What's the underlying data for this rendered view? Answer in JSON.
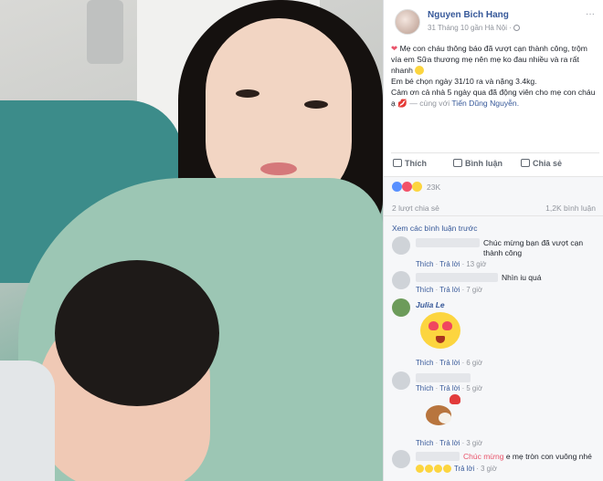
{
  "photo": {
    "description_free": true
  },
  "post": {
    "author": "Nguyen Bich Hang",
    "time": "31 Tháng 10 gần Hà Nội ·",
    "more": "···",
    "line1": "Mẹ con cháu thông báo đã vượt cạn thành công, trộm vía em Sữa thương mẹ nên mẹ ko đau nhiều và ra rất nhanh",
    "line2": "Em bé chọn ngày 31/10 ra và nặng 3.4kg.",
    "line3": "Cảm ơn cả nhà 5 ngày qua đã động viên cho mẹ con cháu ạ",
    "with_text": "— cùng với",
    "tagged": "Tiến Dũng Nguyễn."
  },
  "actions": {
    "like": "Thích",
    "comment": "Bình luận",
    "share": "Chia sẻ"
  },
  "reactions": {
    "count": "23K"
  },
  "stats": {
    "shares": "2 lượt chia sẻ",
    "comments": "1,2K bình luận"
  },
  "comments": {
    "prev": "Xem các bình luận trước",
    "items": [
      {
        "text": "Chúc mừng bạn đã vượt cạn thành công",
        "like": "Thích",
        "reply": "Trả lời",
        "time": "13 giờ"
      },
      {
        "text": "Nhìn iu quá",
        "like": "Thích",
        "reply": "Trả lời",
        "time": "7 giờ"
      },
      {
        "name": "Julia Le",
        "like": "Thích",
        "reply": "Trả lời",
        "time": "6 giờ"
      },
      {
        "like": "Thích",
        "reply": "Trả lời",
        "time": "5 giờ"
      },
      {
        "like": "Thích",
        "reply": "Trả lời",
        "time": "3 giờ"
      },
      {
        "hl": "Chúc mừng",
        "text": "e mẹ tròn con vuông nhé",
        "reply": "Trả lời",
        "time": "3 giờ"
      }
    ]
  },
  "colors": {
    "link": "#365899",
    "muted": "#90949c",
    "heart": "#e9546b"
  }
}
